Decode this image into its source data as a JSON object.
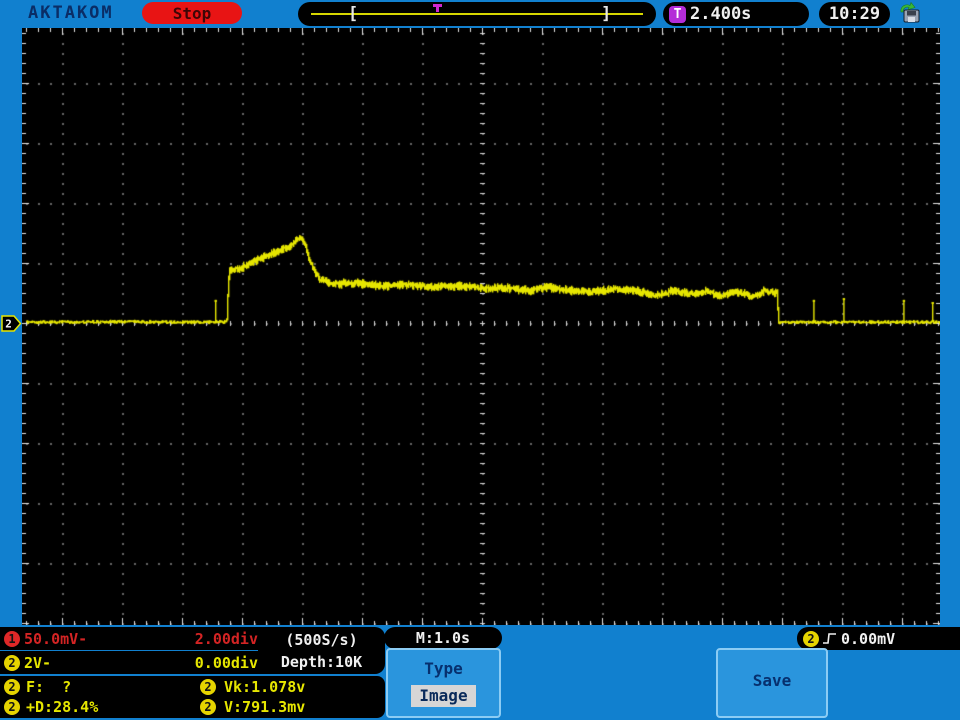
{
  "header": {
    "brand": "AKTAKOM",
    "acq_state": "Stop",
    "trigger_icon": "T",
    "trigger_time": "2.400s",
    "clock": "10:29"
  },
  "window_bar": {
    "left_bracket": "[",
    "right_bracket": "]"
  },
  "channel_marker": {
    "label": "2"
  },
  "footer": {
    "ch1": {
      "badge": "1",
      "scale": "50.0mV-",
      "offset": "2.00div"
    },
    "ch2": {
      "badge": "2",
      "scale": "2V-",
      "offset": "0.00div"
    },
    "sample_rate": "(500S/s)",
    "depth": "Depth:10K",
    "timebase": "M:1.0s",
    "trigger": {
      "badge": "2",
      "level": "0.00mV"
    },
    "measurements": [
      {
        "badge": "2",
        "text": "F:  ?"
      },
      {
        "badge": "2",
        "text": "Vk:1.078v"
      },
      {
        "badge": "2",
        "text": "+D:28.4%"
      },
      {
        "badge": "2",
        "text": "V:791.3mv"
      }
    ],
    "menu": {
      "label": "Type",
      "value": "Image"
    },
    "save_label": "Save"
  },
  "colors": {
    "background_blue": "#1180cf",
    "button_blue": "#2a95dd",
    "trace_yellow": "#e6e600",
    "ch1_red": "#d42424",
    "stop_red": "#e81414",
    "trigger_magenta": "#b42cd8",
    "grid_dot": "#666666",
    "ruler_white": "#e6e6e6"
  },
  "chart_data": {
    "type": "line",
    "title": "Oscilloscope channel 2 trace",
    "xlabel": "time (s), 1.0 s/div",
    "ylabel": "voltage (V), 2 V/div",
    "timebase_s_per_div": 1.0,
    "volts_per_div": 2.0,
    "x_range": [
      -7.6,
      7.63
    ],
    "y_range": [
      -10.0,
      9.8
    ],
    "grid": "dotted graticule, 60 px/div, center crosshair dashes",
    "legend_position": "none",
    "points": [
      [
        -7.6,
        0.03
      ],
      [
        -6.8,
        0.03
      ],
      [
        -6.0,
        0.04
      ],
      [
        -5.2,
        0.03
      ],
      [
        -4.6,
        0.03
      ],
      [
        -4.27,
        0.03
      ],
      [
        -4.23,
        1.7
      ],
      [
        -4.0,
        1.87
      ],
      [
        -3.8,
        2.07
      ],
      [
        -3.6,
        2.23
      ],
      [
        -3.4,
        2.4
      ],
      [
        -3.2,
        2.6
      ],
      [
        -3.1,
        2.77
      ],
      [
        -3.03,
        2.87
      ],
      [
        -2.95,
        2.53
      ],
      [
        -2.88,
        2.07
      ],
      [
        -2.8,
        1.7
      ],
      [
        -2.72,
        1.47
      ],
      [
        -2.5,
        1.3
      ],
      [
        -2.1,
        1.33
      ],
      [
        -1.7,
        1.23
      ],
      [
        -1.3,
        1.27
      ],
      [
        -0.9,
        1.2
      ],
      [
        -0.45,
        1.23
      ],
      [
        0.0,
        1.17
      ],
      [
        0.4,
        1.17
      ],
      [
        0.8,
        1.07
      ],
      [
        1.05,
        1.2
      ],
      [
        1.4,
        1.1
      ],
      [
        1.8,
        1.03
      ],
      [
        2.15,
        1.13
      ],
      [
        2.55,
        1.07
      ],
      [
        2.9,
        0.9
      ],
      [
        3.15,
        1.07
      ],
      [
        3.45,
        0.97
      ],
      [
        3.7,
        1.07
      ],
      [
        3.95,
        0.9
      ],
      [
        4.25,
        1.03
      ],
      [
        4.5,
        0.87
      ],
      [
        4.7,
        1.07
      ],
      [
        4.9,
        1.0
      ],
      [
        4.93,
        0.03
      ],
      [
        5.4,
        0.03
      ],
      [
        6.2,
        0.03
      ],
      [
        7.0,
        0.03
      ],
      [
        7.63,
        0.03
      ]
    ],
    "spikes": [
      [
        -4.45,
        0.77
      ],
      [
        5.52,
        0.77
      ],
      [
        6.02,
        0.83
      ],
      [
        7.02,
        0.77
      ],
      [
        7.5,
        0.7
      ]
    ],
    "baseline_v": 0.03,
    "noise_v_plateau": 0.1,
    "noise_v_baseline": 0.05
  }
}
